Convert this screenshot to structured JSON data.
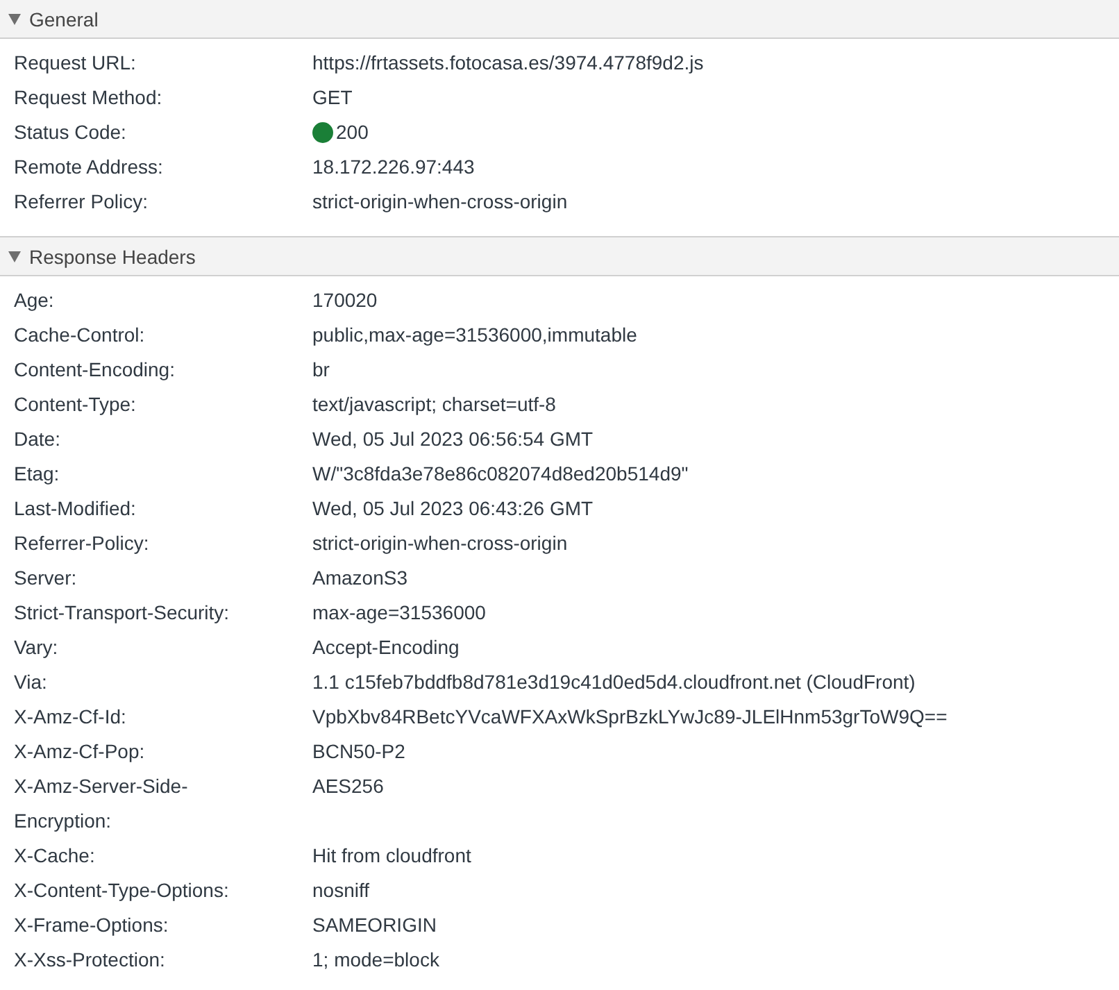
{
  "sections": [
    {
      "title": "General",
      "expanded": true,
      "rows": [
        {
          "name": "Request URL:",
          "value": "https://frtassets.fotocasa.es/3974.4778f9d2.js"
        },
        {
          "name": "Request Method:",
          "value": "GET"
        },
        {
          "name": "Status Code:",
          "value": "200",
          "kind": "status"
        },
        {
          "name": "Remote Address:",
          "value": "18.172.226.97:443"
        },
        {
          "name": "Referrer Policy:",
          "value": "strict-origin-when-cross-origin"
        }
      ]
    },
    {
      "title": "Response Headers",
      "expanded": true,
      "rows": [
        {
          "name": "Age:",
          "value": "170020"
        },
        {
          "name": "Cache-Control:",
          "value": "public,max-age=31536000,immutable"
        },
        {
          "name": "Content-Encoding:",
          "value": "br"
        },
        {
          "name": "Content-Type:",
          "value": "text/javascript; charset=utf-8"
        },
        {
          "name": "Date:",
          "value": "Wed, 05 Jul 2023 06:56:54 GMT"
        },
        {
          "name": "Etag:",
          "value": "W/\"3c8fda3e78e86c082074d8ed20b514d9\""
        },
        {
          "name": "Last-Modified:",
          "value": "Wed, 05 Jul 2023 06:43:26 GMT"
        },
        {
          "name": "Referrer-Policy:",
          "value": "strict-origin-when-cross-origin"
        },
        {
          "name": "Server:",
          "value": "AmazonS3"
        },
        {
          "name": "Strict-Transport-Security:",
          "value": "max-age=31536000"
        },
        {
          "name": "Vary:",
          "value": "Accept-Encoding"
        },
        {
          "name": "Via:",
          "value": "1.1 c15feb7bddfb8d781e3d19c41d0ed5d4.cloudfront.net (CloudFront)"
        },
        {
          "name": "X-Amz-Cf-Id:",
          "value": "VpbXbv84RBetcYVcaWFXAxWkSprBzkLYwJc89-JLElHnm53grToW9Q=="
        },
        {
          "name": "X-Amz-Cf-Pop:",
          "value": "BCN50-P2"
        },
        {
          "name": "X-Amz-Server-Side-Encryption:",
          "value": "AES256"
        },
        {
          "name": "X-Cache:",
          "value": "Hit from cloudfront"
        },
        {
          "name": "X-Content-Type-Options:",
          "value": "nosniff"
        },
        {
          "name": "X-Frame-Options:",
          "value": "SAMEORIGIN"
        },
        {
          "name": "X-Xss-Protection:",
          "value": "1; mode=block"
        }
      ]
    }
  ]
}
